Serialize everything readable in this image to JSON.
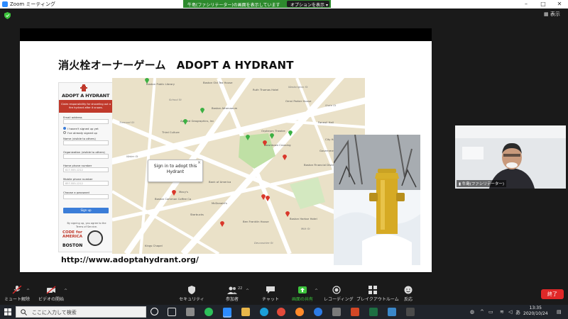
{
  "window": {
    "app_title": "Zoom ミーティング",
    "share_banner": "牛島(ファシリテーター)の画面を表示しています",
    "options_label": "オプションを表示",
    "view_label": "表示"
  },
  "slide": {
    "title": "消火栓オーナーゲーム　ADOPT A HYDRANT",
    "url": "http://www.adoptahydrant.org/",
    "panel": {
      "logo": "ADOPT A HYDRANT",
      "tagline": "Claim responsibility for shoveling out a fire hydrant after it snows.",
      "email_label": "Email address",
      "signup_new": "I haven't signed up yet",
      "signup_existing": "I've already signed up",
      "name_label": "Name (visible to others)",
      "org_label": "Organization (visible to others)",
      "home_phone_label": "Home phone number",
      "home_phone_placeholder": "617-555-1212",
      "mobile_phone_label": "Mobile phone number",
      "mobile_phone_placeholder": "857-555-1212",
      "password_label": "Choose a password",
      "signup_button": "Sign up",
      "terms": "By signing up, you agree to the Terms of Service.",
      "cfa": "CODE for AMERICA",
      "boston": "BOSTON"
    },
    "map": {
      "popup_line1": "Sign in to adopt this",
      "popup_line2": "Hydrant",
      "popup_close": "×",
      "places": [
        "Boston Public Library",
        "Boston Old Tea House",
        "Ruth Thomas Hotel",
        "Omni Parker House",
        "Applied Geographics, Inc",
        "Third Culture",
        "Orpheum Theatre",
        "Downtown Crossing",
        "Boston Athenaeum",
        "Boston Financial District",
        "Bank of America",
        "Ben Franklin House",
        "Faneuil Hall",
        "City Hall Plaza",
        "Government Center",
        "Boston Common Coffee Co",
        "Macy's",
        "McDonald's",
        "Starbucks",
        "Boston Harbor Hotel",
        "Kings Chapel",
        "Milk St",
        "Water St",
        "School St",
        "Tremont St",
        "Washington St",
        "State St",
        "Devonshire St"
      ]
    }
  },
  "video": {
    "name": "牛島(ファシリテーター)"
  },
  "controls": {
    "mute": "ミュート解除",
    "video": "ビデオの開始",
    "security": "セキュリティ",
    "participants": "参加者",
    "participants_count": "22",
    "chat": "チャット",
    "share": "画面の共有",
    "record": "レコーディング",
    "breakout": "ブレイクアウトルーム",
    "reactions": "反応",
    "end": "終了"
  },
  "taskbar": {
    "search_placeholder": "ここに入力して検索",
    "time": "13:35",
    "date": "2020/10/24",
    "ime": "あ"
  },
  "colors": {
    "zoom_blue": "#2d8cff",
    "share_green": "#2d8a2d",
    "end_red": "#e02828",
    "hydrant_red": "#c0392b"
  }
}
